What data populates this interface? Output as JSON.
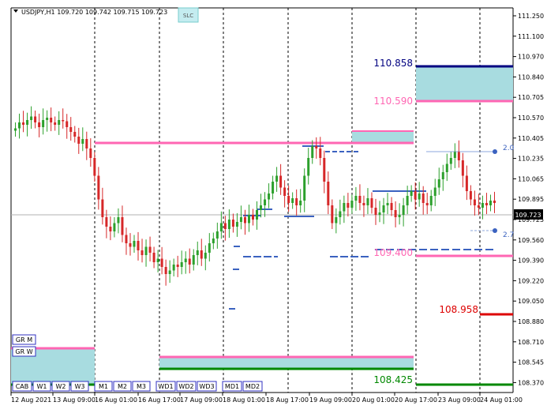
{
  "chart_data": {
    "type": "candlestick",
    "header": {
      "symbol": "USDJPY,H1",
      "o": "109.720",
      "h": "109.742",
      "l": "109.715",
      "c": "109.723"
    },
    "slc_label": "SLC",
    "y_ticks": [
      "111.250",
      "111.100",
      "110.970",
      "110.840",
      "110.705",
      "110.570",
      "110.405",
      "110.235",
      "110.065",
      "109.895",
      "109.725",
      "109.560",
      "109.390",
      "109.220",
      "109.050",
      "108.880",
      "108.710",
      "108.545",
      "108.370"
    ],
    "ylim": [
      108.3,
      111.3
    ],
    "current_price": "109.723",
    "x_ticks": [
      "12 Aug 2021",
      "13 Aug 09:00",
      "16 Aug 01:00",
      "16 Aug 17:00",
      "17 Aug 09:00",
      "18 Aug 01:00",
      "18 Aug 17:00",
      "19 Aug 09:00",
      "20 Aug 01:00",
      "20 Aug 17:00",
      "23 Aug 09:00",
      "24 Aug 01:00"
    ],
    "levels": [
      {
        "label": "110.858",
        "value": 110.858,
        "color": "#000080"
      },
      {
        "label": "110.590",
        "value": 110.59,
        "color": "#ff66b3"
      },
      {
        "label": "109.400",
        "value": 109.4,
        "color": "#ff66b3"
      },
      {
        "label": "108.958",
        "value": 108.958,
        "color": "#dd0000"
      },
      {
        "label": "108.425",
        "value": 108.425,
        "color": "#008800"
      }
    ],
    "side_labels": [
      {
        "label": "2.0",
        "value": 110.2
      },
      {
        "label": "2.7",
        "value": 109.55
      }
    ],
    "zone_buttons_left": [
      "GR M",
      "GR W"
    ],
    "period_buttons": [
      "CAB",
      "W1",
      "W2",
      "W3",
      "M1",
      "M2",
      "M3",
      "WD1",
      "WD2",
      "WD3",
      "MD1",
      "MD2"
    ],
    "closes": [
      110.35,
      110.4,
      110.38,
      110.42,
      110.45,
      110.4,
      110.36,
      110.42,
      110.44,
      110.4,
      110.38,
      110.42,
      110.41,
      110.36,
      110.32,
      110.28,
      110.22,
      110.26,
      110.18,
      110.1,
      109.95,
      109.75,
      109.6,
      109.52,
      109.48,
      109.55,
      109.6,
      109.45,
      109.38,
      109.35,
      109.4,
      109.32,
      109.28,
      109.35,
      109.3,
      109.22,
      109.25,
      109.18,
      109.12,
      109.15,
      109.2,
      109.18,
      109.22,
      109.25,
      109.2,
      109.28,
      109.32,
      109.25,
      109.3,
      109.38,
      109.42,
      109.48,
      109.55,
      109.5,
      109.58,
      109.52,
      109.56,
      109.6,
      109.55,
      109.62,
      109.58,
      109.66,
      109.7,
      109.75,
      109.8,
      109.9,
      109.95,
      109.85,
      109.78,
      109.72,
      109.76,
      109.7,
      109.74,
      109.95,
      110.1,
      110.2,
      110.18,
      110.1,
      109.9,
      109.7,
      109.55,
      109.6,
      109.65,
      109.72,
      109.68,
      109.74,
      109.78,
      109.72,
      109.7,
      109.76,
      109.68,
      109.62,
      109.64,
      109.7,
      109.72,
      109.66,
      109.6,
      109.62,
      109.7,
      109.78,
      109.82,
      109.75,
      109.8,
      109.72,
      109.7,
      109.78,
      109.85,
      109.92,
      109.98,
      110.05,
      110.1,
      110.15,
      110.08,
      109.95,
      109.82,
      109.75,
      109.7,
      109.68,
      109.72,
      109.7,
      109.74,
      109.72
    ]
  }
}
